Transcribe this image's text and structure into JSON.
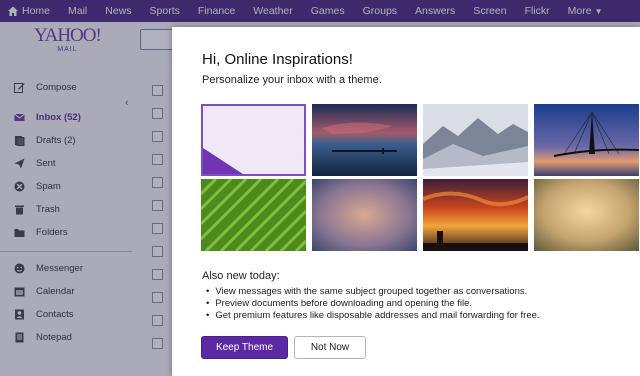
{
  "topnav": {
    "items": [
      {
        "label": "Home",
        "icon": "home-icon"
      },
      {
        "label": "Mail"
      },
      {
        "label": "News"
      },
      {
        "label": "Sports"
      },
      {
        "label": "Finance"
      },
      {
        "label": "Weather"
      },
      {
        "label": "Games"
      },
      {
        "label": "Groups"
      },
      {
        "label": "Answers"
      },
      {
        "label": "Screen"
      },
      {
        "label": "Flickr"
      },
      {
        "label": "More"
      }
    ]
  },
  "logo": {
    "line1": "YAHOO!",
    "line2": "MAIL"
  },
  "sidebar": {
    "items": [
      {
        "label": "Compose",
        "icon": "compose-icon"
      },
      {
        "label": "Inbox (52)",
        "icon": "inbox-icon"
      },
      {
        "label": "Drafts (2)",
        "icon": "drafts-icon"
      },
      {
        "label": "Sent",
        "icon": "sent-icon"
      },
      {
        "label": "Spam",
        "icon": "spam-icon"
      },
      {
        "label": "Trash",
        "icon": "trash-icon"
      },
      {
        "label": "Folders",
        "icon": "folder-icon"
      },
      {
        "label": "Messenger",
        "icon": "messenger-icon"
      },
      {
        "label": "Calendar",
        "icon": "calendar-icon"
      },
      {
        "label": "Contacts",
        "icon": "contacts-icon"
      },
      {
        "label": "Notepad",
        "icon": "notepad-icon"
      }
    ]
  },
  "modal": {
    "title": "Hi, Online Inspirations!",
    "subtitle": "Personalize your inbox with a theme.",
    "also_new": "Also new today:",
    "bullets": [
      "View messages with the same subject grouped together as conversations.",
      "Preview documents before downloading and opening the file.",
      "Get premium features like disposable addresses and mail forwarding for free."
    ],
    "keep_label": "Keep Theme",
    "not_now_label": "Not Now",
    "themes": [
      {
        "name": "purple-default-theme",
        "selected": true
      },
      {
        "name": "pier-dusk-theme"
      },
      {
        "name": "mountain-mist-theme"
      },
      {
        "name": "bridge-sunset-theme"
      },
      {
        "name": "green-leaf-theme"
      },
      {
        "name": "soft-blur-theme"
      },
      {
        "name": "fiery-sky-theme"
      },
      {
        "name": "warm-haze-theme"
      }
    ]
  },
  "colors": {
    "nav": "#3a1873",
    "accent": "#5b2aa3",
    "brand": "#5b2d9c"
  }
}
